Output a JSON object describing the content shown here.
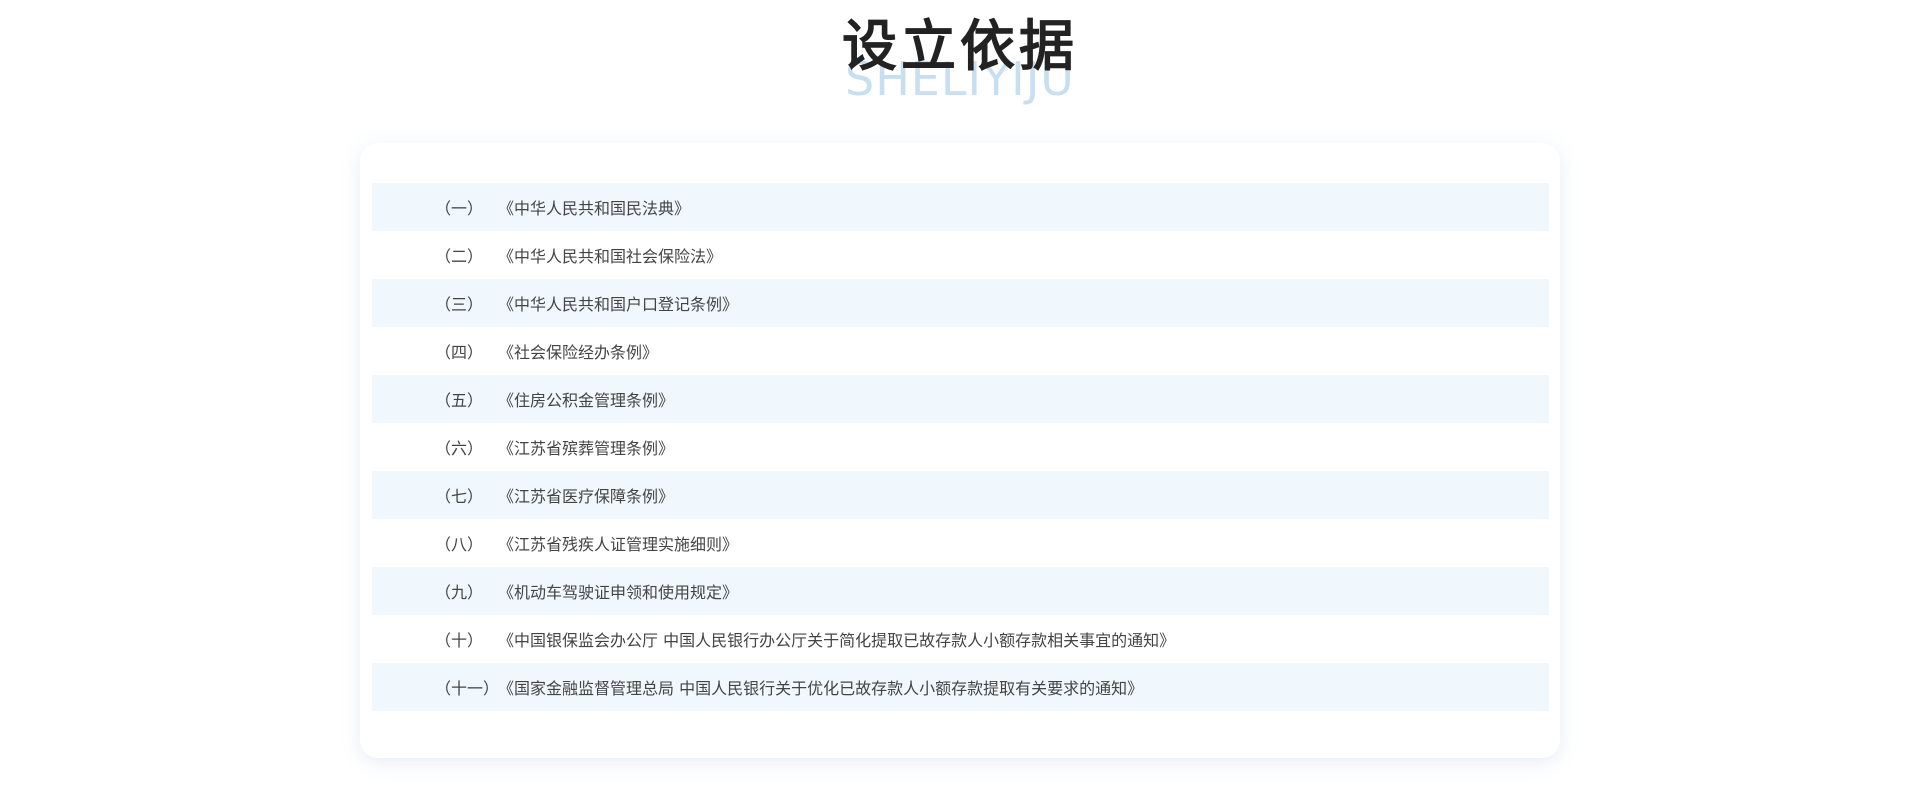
{
  "heading": {
    "title": "设立依据",
    "subtitle": "SHELIYIJU"
  },
  "colors": {
    "title": "#222222",
    "subtitle": "#c8dff2",
    "row_alt_bg": "#f0f7fd",
    "text": "#444444"
  },
  "items": [
    {
      "num": "（一）",
      "text": "《中华人民共和国民法典》"
    },
    {
      "num": "（二）",
      "text": "《中华人民共和国社会保险法》"
    },
    {
      "num": "（三）",
      "text": "《中华人民共和国户口登记条例》"
    },
    {
      "num": "（四）",
      "text": "《社会保险经办条例》"
    },
    {
      "num": "（五）",
      "text": "《住房公积金管理条例》"
    },
    {
      "num": "（六）",
      "text": "《江苏省殡葬管理条例》"
    },
    {
      "num": "（七）",
      "text": "《江苏省医疗保障条例》"
    },
    {
      "num": "（八）",
      "text": "《江苏省残疾人证管理实施细则》"
    },
    {
      "num": "（九）",
      "text": "《机动车驾驶证申领和使用规定》"
    },
    {
      "num": "（十）",
      "text": "《中国银保监会办公厅 中国人民银行办公厅关于简化提取已故存款人小额存款相关事宜的通知》"
    },
    {
      "num": "（十一）",
      "text": "《国家金融监督管理总局 中国人民银行关于优化已故存款人小额存款提取有关要求的通知》"
    }
  ]
}
